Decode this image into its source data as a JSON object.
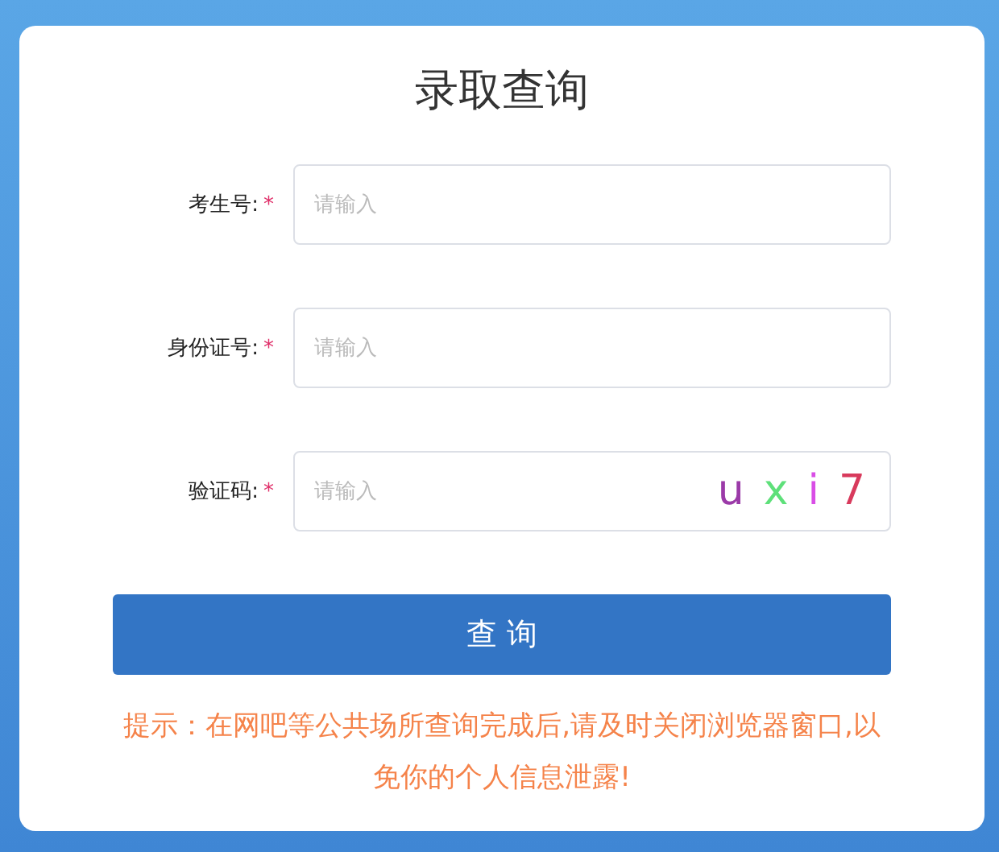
{
  "title": "录取查询",
  "fields": [
    {
      "label": "考生号:",
      "required_mark": "*",
      "placeholder": "请输入",
      "kind": "text"
    },
    {
      "label": "身份证号:",
      "required_mark": "*",
      "placeholder": "请输入",
      "kind": "text"
    },
    {
      "label": "验证码:",
      "required_mark": "*",
      "placeholder": "请输入",
      "kind": "captcha",
      "captcha": [
        {
          "char": "u",
          "color": "#9b3aa8"
        },
        {
          "char": "x",
          "color": "#5ee07a"
        },
        {
          "char": "i",
          "color": "#d94ee6"
        },
        {
          "char": "7",
          "color": "#d83a5c"
        }
      ]
    }
  ],
  "submit": "查 询",
  "hint": "提示：在网吧等公共场所查询完成后,请及时关闭浏览器窗口,以免你的个人信息泄露!"
}
